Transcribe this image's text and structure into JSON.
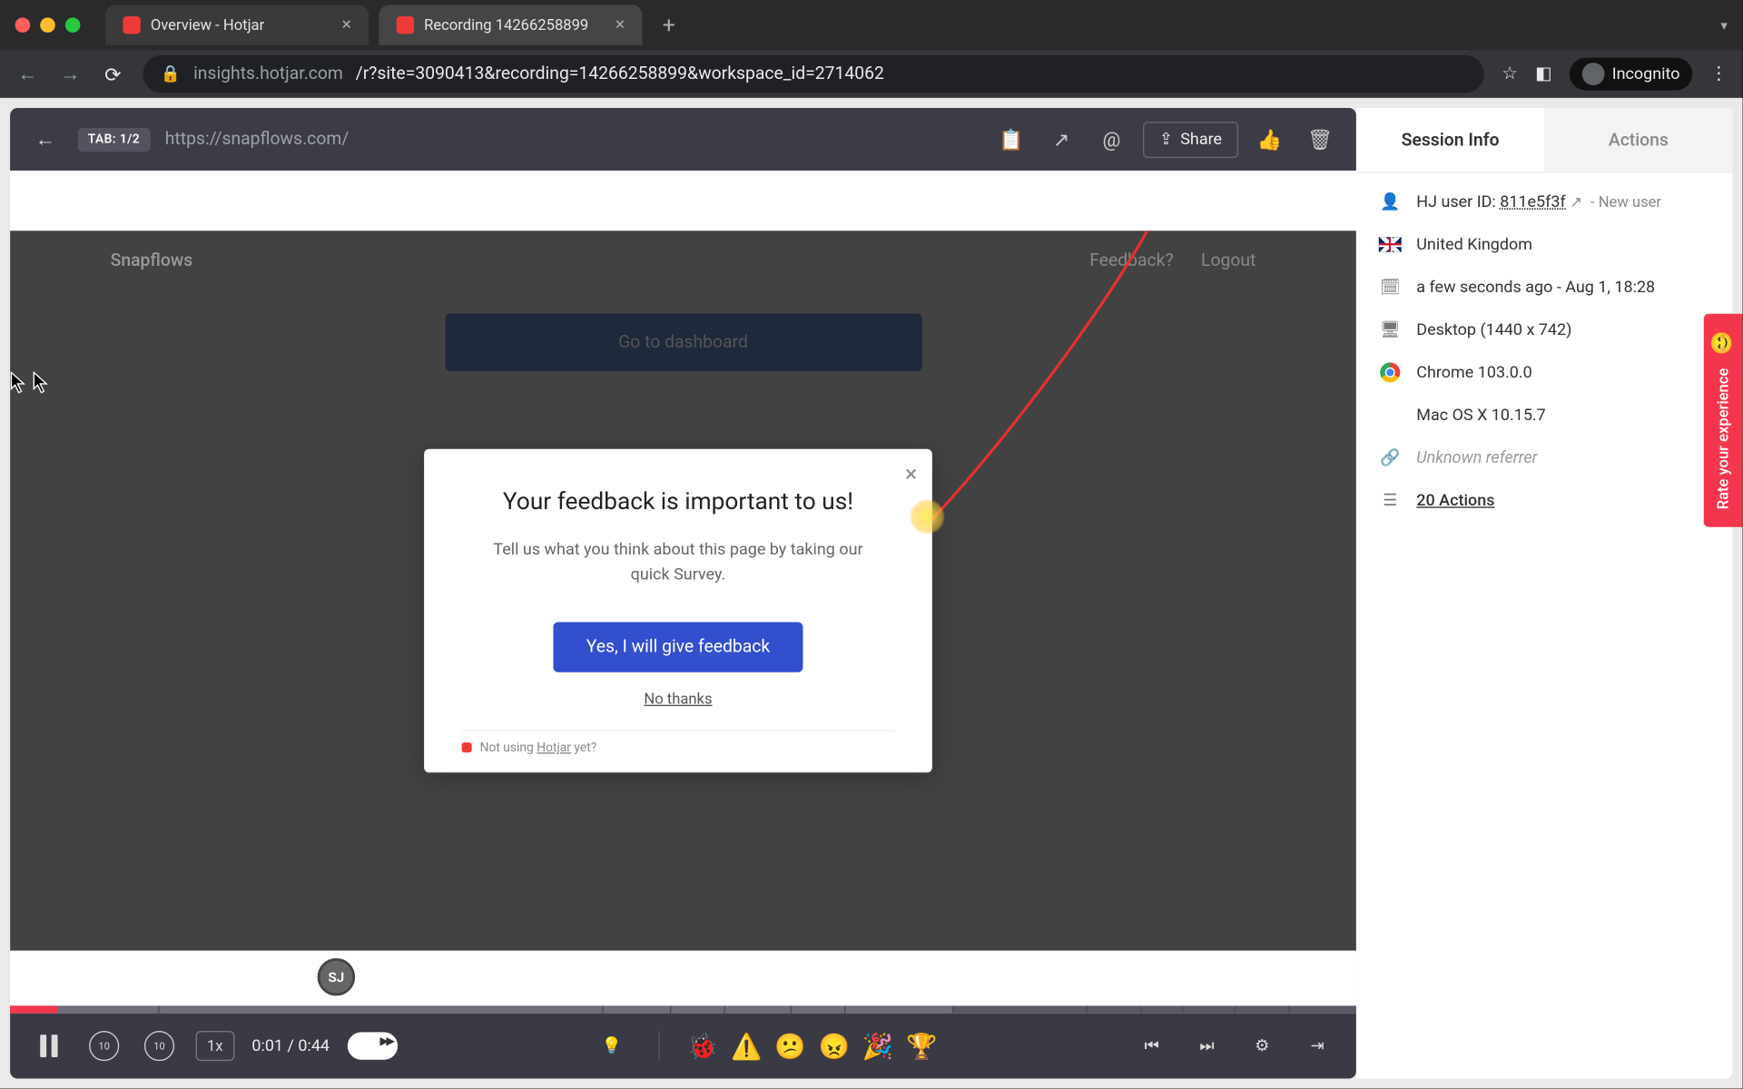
{
  "browser": {
    "tabs": [
      {
        "title": "Overview - Hotjar",
        "active": false
      },
      {
        "title": "Recording 14266258899",
        "active": true
      }
    ],
    "url_host": "insights.hotjar.com",
    "url_path": "/r?site=3090413&recording=14266258899&workspace_id=2714062",
    "incognito_label": "Incognito"
  },
  "player_toolbar": {
    "tab_badge": "TAB: 1/2",
    "page_url": "https://snapflows.com/",
    "share_label": "Share"
  },
  "recorded_page": {
    "brand": "Snapflows",
    "nav_feedback": "Feedback?",
    "nav_logout": "Logout",
    "dashboard_btn": "Go to dashboard"
  },
  "feedback_modal": {
    "title": "Your feedback is important to us!",
    "subtitle": "Tell us what you think about this page by taking our quick Survey.",
    "primary_btn": "Yes, I will give feedback",
    "secondary": "No thanks",
    "footer_prefix": "Not using ",
    "footer_link": "Hotjar",
    "footer_suffix": " yet?"
  },
  "rate_tab": "Rate your experience",
  "controls": {
    "speed": "1x",
    "time_current": "0:01",
    "time_total": "0:44",
    "avatar_initials": "SJ"
  },
  "side": {
    "tab_session": "Session Info",
    "tab_actions": "Actions",
    "user_label": "HJ user ID:",
    "user_id": "811e5f3f",
    "new_user": "- New user",
    "country": "United Kingdom",
    "time": "a few seconds ago - Aug 1, 18:28",
    "device": "Desktop (1440 x 742)",
    "browser": "Chrome 103.0.0",
    "os": "Mac OS X 10.15.7",
    "referrer": "Unknown referrer",
    "actions_link": "20 Actions"
  }
}
